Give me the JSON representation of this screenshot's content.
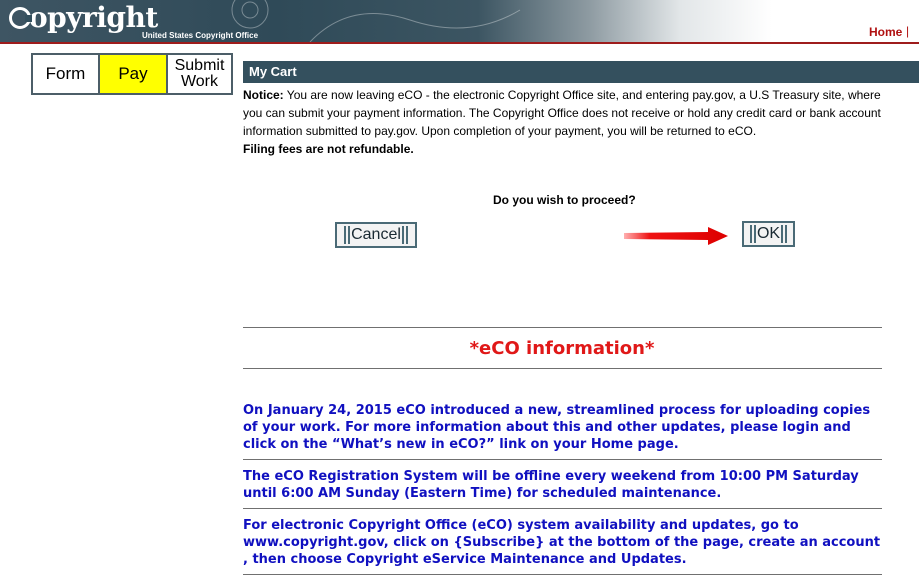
{
  "header": {
    "logo_text": "opyright",
    "logo_subtitle": "United States Copyright Office",
    "home_link": "Home",
    "separator": "|"
  },
  "steps": {
    "form": "Form",
    "pay": "Pay",
    "submit_line1": "Submit",
    "submit_line2": "Work",
    "active_color": "#ffff00"
  },
  "cart": {
    "title": "My Cart",
    "notice_label": "Notice:",
    "notice_text": " You are now leaving eCO - the electronic Copyright Office site, and entering pay.gov, a U.S Treasury site, where you can submit your payment information. The Copyright Office does not receive or hold any credit card or bank account information submitted to pay.gov. Upon completion of your payment, you will be returned to eCO.",
    "fees_note": "Filing fees are not refundable.",
    "question": "Do you wish to proceed?",
    "cancel_label": "Cancel",
    "ok_label": "OK"
  },
  "info": {
    "title": "*eCO information*",
    "messages": [
      "On January 24, 2015 eCO introduced a new, streamlined process for uploading copies of your work. For more information about this and other updates, please login and click on the “What’s new in eCO?” link on your Home page.",
      "The eCO Registration System will be offline every weekend from 10:00 PM Saturday until 6:00 AM Sunday (Eastern Time) for scheduled maintenance.",
      "For electronic Copyright Office (eCO) system availability and updates, go to www.copyright.gov, click on {Subscribe} at the bottom of the page, create an account , then choose Copyright eService Maintenance and Updates."
    ]
  },
  "colors": {
    "header_bar": "#34505e",
    "accent_red": "#b01010",
    "info_title": "#e01818",
    "message_blue": "#1010c0"
  },
  "icons": {
    "arrow": "red-right-arrow-icon"
  }
}
